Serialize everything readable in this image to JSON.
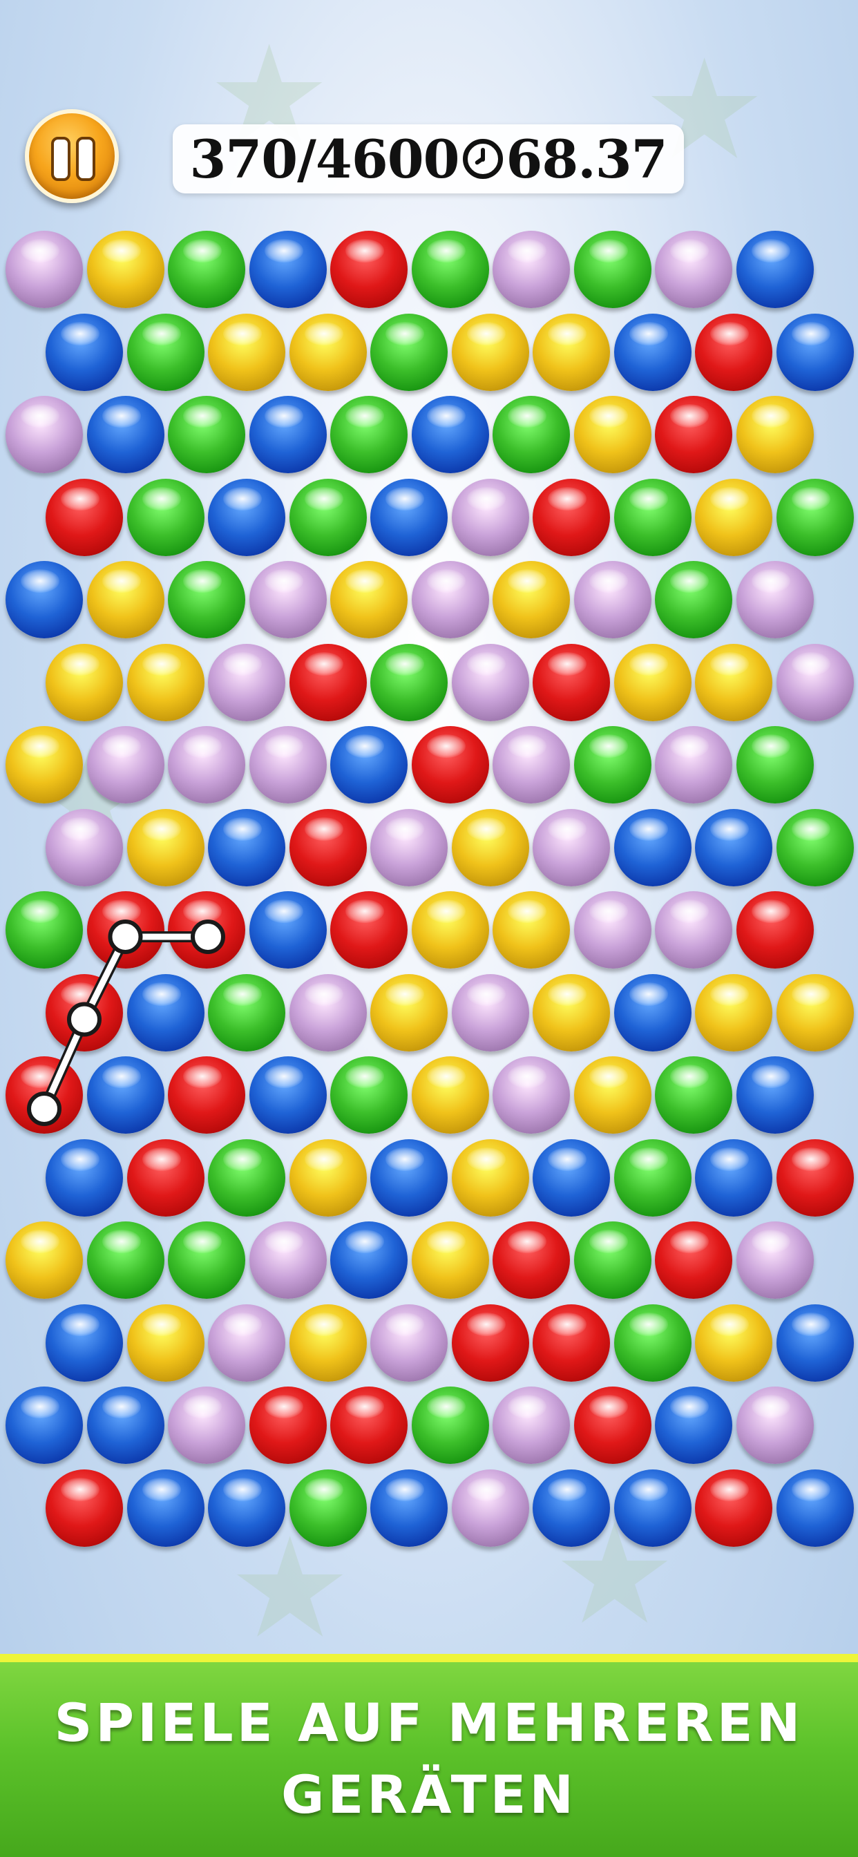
{
  "hud": {
    "score": "370/4600",
    "time": "68.37"
  },
  "banner": {
    "line1": "SPIELE AUF MEHREREN",
    "line2": "GERÄTEN"
  },
  "colors": {
    "purple": "#c9a2d9",
    "yellow": "#f0c21a",
    "green": "#3cbf2a",
    "blue": "#1f63d6",
    "red": "#e01818",
    "background": "#c9dcf2",
    "banner_green": "#5cc22a",
    "banner_stripe": "#eef53a",
    "pause_orange": "#f7a51c"
  },
  "board": {
    "rows": [
      [
        "P",
        "Y",
        "G",
        "B",
        "R",
        "G",
        "P",
        "G",
        "P",
        "B"
      ],
      [
        "B",
        "G",
        "Y",
        "Y",
        "G",
        "Y",
        "Y",
        "B",
        "R",
        "B"
      ],
      [
        "P",
        "B",
        "G",
        "B",
        "G",
        "B",
        "G",
        "Y",
        "R",
        "Y"
      ],
      [
        "R",
        "G",
        "B",
        "G",
        "B",
        "P",
        "R",
        "G",
        "Y",
        "G"
      ],
      [
        "B",
        "Y",
        "G",
        "P",
        "Y",
        "P",
        "Y",
        "P",
        "G",
        "P"
      ],
      [
        "Y",
        "Y",
        "P",
        "R",
        "G",
        "P",
        "R",
        "Y",
        "Y",
        "P"
      ],
      [
        "Y",
        "P",
        "P",
        "P",
        "B",
        "R",
        "P",
        "G",
        "P",
        "G"
      ],
      [
        "P",
        "Y",
        "B",
        "R",
        "P",
        "Y",
        "P",
        "B",
        "B",
        "G"
      ],
      [
        "G",
        "R",
        "R",
        "B",
        "R",
        "Y",
        "Y",
        "P",
        "P",
        "R"
      ],
      [
        "R",
        "B",
        "G",
        "P",
        "Y",
        "P",
        "Y",
        "B",
        "Y",
        "Y"
      ],
      [
        "R",
        "B",
        "R",
        "B",
        "G",
        "Y",
        "P",
        "Y",
        "G",
        "B"
      ],
      [
        "B",
        "R",
        "G",
        "Y",
        "B",
        "Y",
        "B",
        "G",
        "B",
        "R"
      ],
      [
        "Y",
        "G",
        "G",
        "P",
        "B",
        "Y",
        "R",
        "G",
        "R",
        "P"
      ],
      [
        "B",
        "Y",
        "P",
        "Y",
        "P",
        "R",
        "R",
        "G",
        "Y",
        "B"
      ],
      [
        "B",
        "B",
        "P",
        "R",
        "R",
        "G",
        "P",
        "R",
        "B",
        "P"
      ],
      [
        "R",
        "B",
        "B",
        "G",
        "B",
        "P",
        "B",
        "B",
        "R",
        "B"
      ]
    ],
    "selected_path": [
      [
        10,
        0
      ],
      [
        9,
        0
      ],
      [
        8,
        1
      ],
      [
        8,
        2
      ]
    ]
  }
}
